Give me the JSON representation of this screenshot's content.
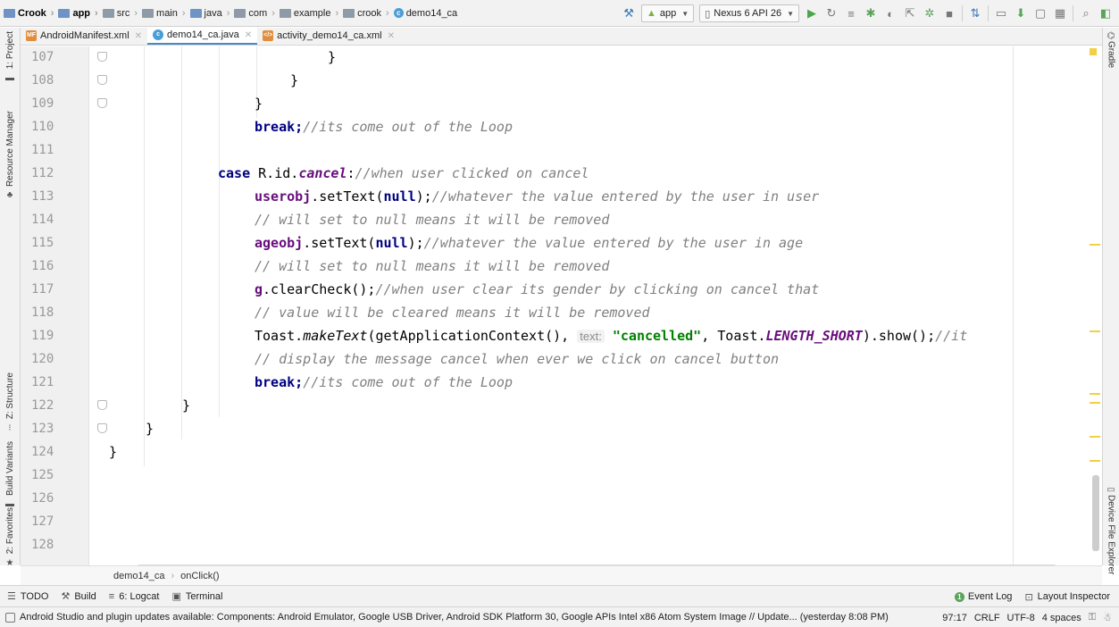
{
  "navbar": {
    "crumbs": [
      "Crook",
      "app",
      "src",
      "main",
      "java",
      "com",
      "example",
      "crook",
      "demo14_ca"
    ],
    "run_config": "app",
    "device": "Nexus 6 API 26"
  },
  "left_tools": [
    "1: Project",
    "Resource Manager",
    "Z: Structure",
    "Build Variants",
    "2: Favorites"
  ],
  "right_tools": [
    "Gradle",
    "Device File Explorer"
  ],
  "editor_tabs": [
    {
      "label": "AndroidManifest.xml",
      "type": "xml"
    },
    {
      "label": "demo14_ca.java",
      "type": "java",
      "active": true
    },
    {
      "label": "activity_demo14_ca.xml",
      "type": "xml"
    }
  ],
  "code": {
    "line_numbers": [
      "107",
      "108",
      "109",
      "110",
      "111",
      "112",
      "113",
      "114",
      "115",
      "116",
      "117",
      "118",
      "119",
      "120",
      "121",
      "122",
      "123",
      "124",
      "125",
      "126",
      "127",
      "128"
    ],
    "lines": {
      "l107": "}",
      "l108": "}",
      "l109": "}",
      "l110_kw": "break",
      "l110_rest": ";",
      "l110_cm": "//its come out of the Loop",
      "l112_kw": "case",
      "l112_a": " R.id.",
      "l112_field": "cancel",
      "l112_b": ":",
      "l112_cm": "//when user clicked on cancel",
      "l113_obj": "userobj",
      "l113_a": ".setText(",
      "l113_null": "null",
      "l113_b": ");",
      "l113_cm": "//whatever the value entered by the user in user",
      "l114_cm": "// will set to null means it will be removed",
      "l115_obj": "ageobj",
      "l115_a": ".setText(",
      "l115_null": "null",
      "l115_b": ");",
      "l115_cm": "//whatever the value entered by the user in age",
      "l116_cm": "// will set to null means it will be removed",
      "l117_obj": "g",
      "l117_a": ".clearCheck();",
      "l117_cm": "//when user clear its gender by clicking on cancel that",
      "l118_cm": "// value will be cleared means it will be removed",
      "l119_a": "Toast.",
      "l119_m": "makeText",
      "l119_b": "(getApplicationContext(), ",
      "l119_hint": "text:",
      "l119_str": "\"cancelled\"",
      "l119_c": ", Toast.",
      "l119_const": "LENGTH_SHORT",
      "l119_d": ").show();",
      "l119_cm": "//it",
      "l120_cm": "// display the message cancel when ever we click on cancel button",
      "l121_kw": "break",
      "l121_rest": ";",
      "l121_cm": "//its come out of the Loop",
      "l122": "}",
      "l123": "}",
      "l124": "}"
    }
  },
  "editor_breadcrumb": [
    "demo14_ca",
    "onClick()"
  ],
  "tool_windows": [
    "TODO",
    "Build",
    "6: Logcat",
    "Terminal"
  ],
  "tool_windows_right": [
    "Event Log",
    "Layout Inspector"
  ],
  "status": {
    "message": "Android Studio and plugin updates available: Components: Android Emulator, Google USB Driver, Android SDK Platform 30, Google APIs Intel x86 Atom System Image // Update... (yesterday 8:08 PM)",
    "position": "97:17",
    "line_sep": "CRLF",
    "encoding": "UTF-8",
    "indent": "4 spaces"
  },
  "colors": {
    "keyword": "#000080",
    "comment": "#808080",
    "string": "#008000",
    "field": "#660e7a",
    "marker": "#f2d043"
  }
}
